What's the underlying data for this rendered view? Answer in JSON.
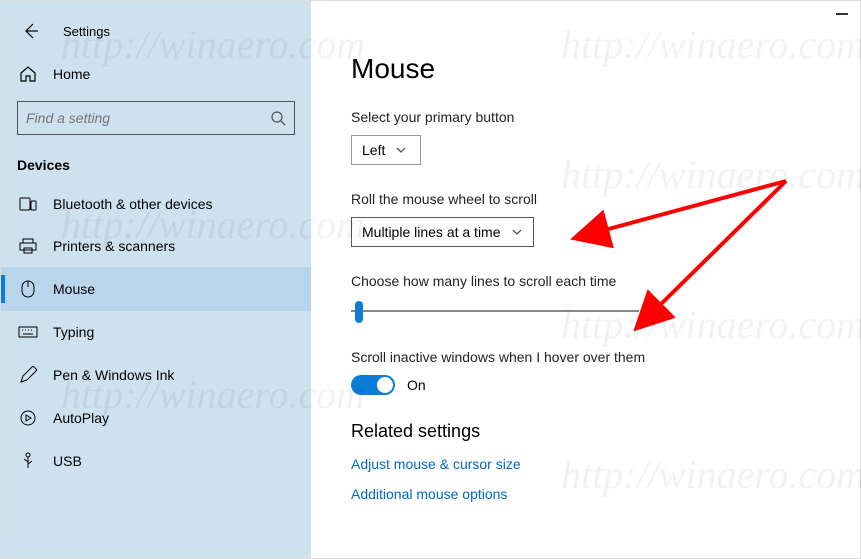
{
  "window": {
    "title": "Settings"
  },
  "sidebar": {
    "home_label": "Home",
    "search_placeholder": "Find a setting",
    "group_label": "Devices",
    "items": [
      {
        "label": "Bluetooth & other devices"
      },
      {
        "label": "Printers & scanners"
      },
      {
        "label": "Mouse"
      },
      {
        "label": "Typing"
      },
      {
        "label": "Pen & Windows Ink"
      },
      {
        "label": "AutoPlay"
      },
      {
        "label": "USB"
      }
    ],
    "selected_index": 2
  },
  "main": {
    "page_title": "Mouse",
    "primary_button": {
      "label": "Select your primary button",
      "value": "Left"
    },
    "wheel_scroll": {
      "label": "Roll the mouse wheel to scroll",
      "value": "Multiple lines at a time"
    },
    "lines_to_scroll": {
      "label": "Choose how many lines to scroll each time",
      "value": 3,
      "min": 1,
      "max": 100
    },
    "inactive_scroll": {
      "label": "Scroll inactive windows when I hover over them",
      "value": true,
      "state_text": "On"
    },
    "related": {
      "heading": "Related settings",
      "links": [
        "Adjust mouse & cursor size",
        "Additional mouse options"
      ]
    }
  },
  "watermark": "http://winaero.com"
}
